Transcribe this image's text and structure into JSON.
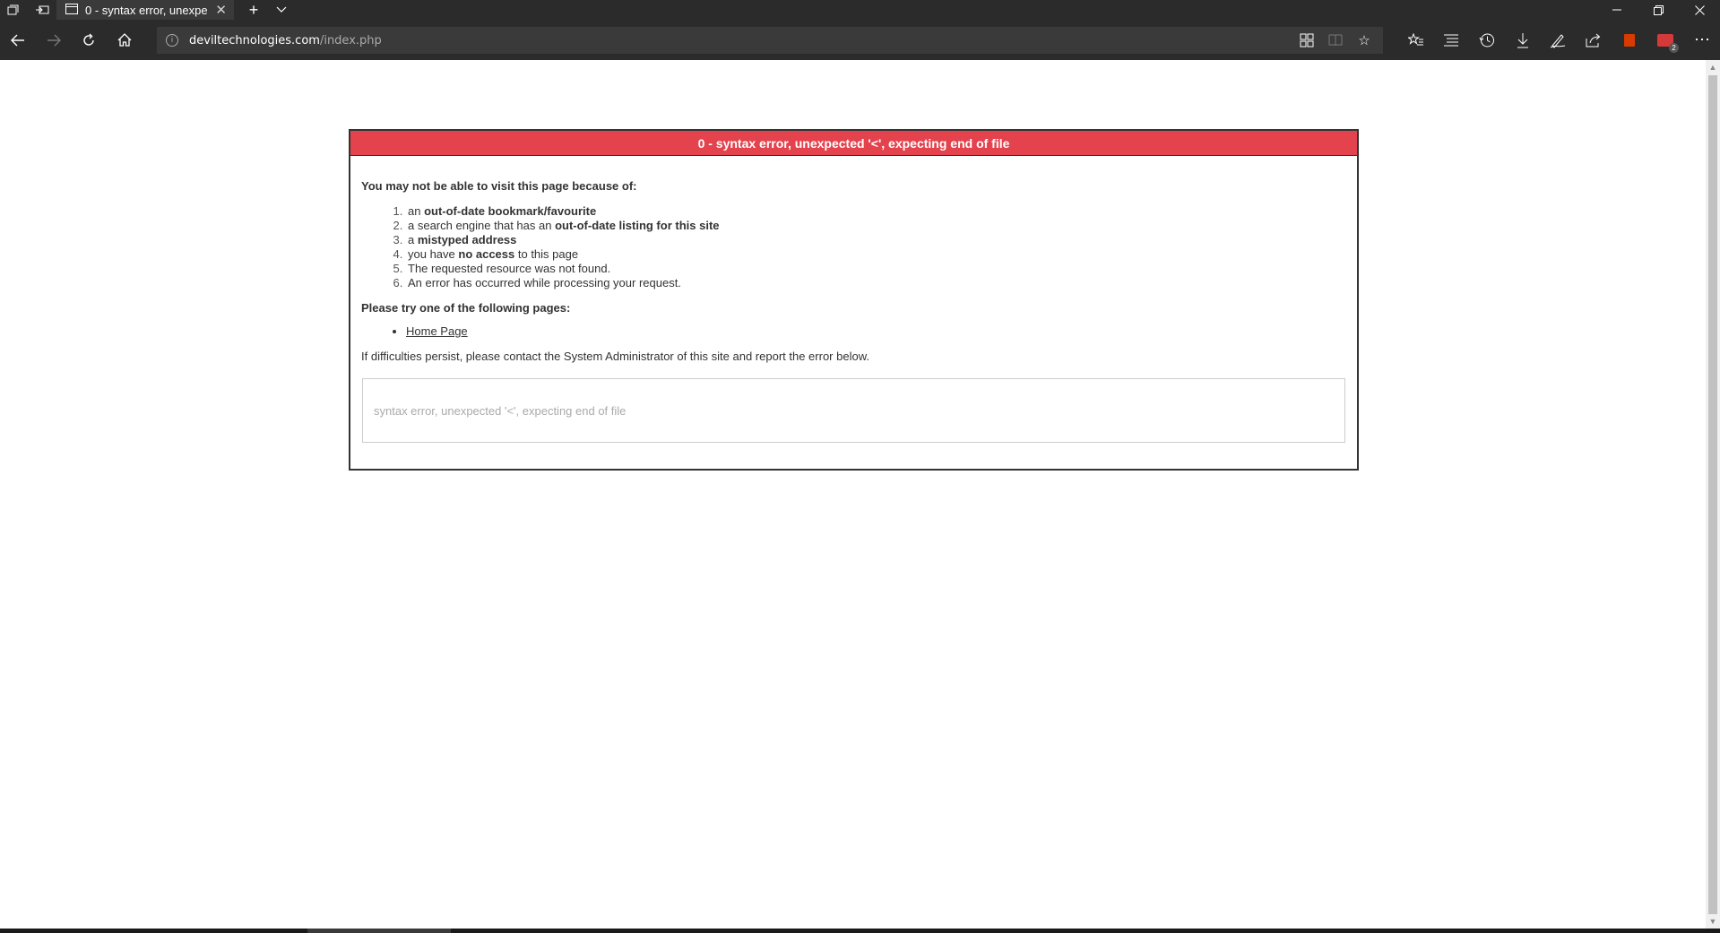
{
  "browser": {
    "tab_title": "0 - syntax error, unexpe",
    "address_domain": "deviltechnologies.com",
    "address_path": "/index.php",
    "extension_badge_count": "2"
  },
  "page": {
    "error_title": "0 - syntax error, unexpected '<', expecting end of file",
    "reasons_heading": "You may not be able to visit this page because of:",
    "reasons": [
      {
        "num": "1.",
        "pre": "an ",
        "bold": "out-of-date bookmark/favourite",
        "post": ""
      },
      {
        "num": "2.",
        "pre": "a search engine that has an ",
        "bold": "out-of-date listing for this site",
        "post": ""
      },
      {
        "num": "3.",
        "pre": "a ",
        "bold": "mistyped address",
        "post": ""
      },
      {
        "num": "4.",
        "pre": "you have ",
        "bold": "no access",
        "post": " to this page"
      },
      {
        "num": "5.",
        "pre": "The requested resource was not found.",
        "bold": "",
        "post": ""
      },
      {
        "num": "6.",
        "pre": "An error has occurred while processing your request.",
        "bold": "",
        "post": ""
      }
    ],
    "try_heading": "Please try one of the following pages:",
    "home_link": "Home Page",
    "contact_text": "If difficulties persist, please contact the System Administrator of this site and report the error below.",
    "error_detail": "syntax error, unexpected '<', expecting end of file"
  },
  "icons": {
    "tabs_aside": "tabs-aside-icon",
    "set_aside": "set-aside-icon",
    "tab_page": "page-icon",
    "close": "close-icon",
    "new_tab": "plus-icon",
    "tab_list": "chevron-down-icon",
    "back": "back-arrow-icon",
    "forward": "forward-arrow-icon",
    "refresh": "refresh-icon",
    "home": "home-icon"
  },
  "colors": {
    "error_header": "#e4424d",
    "chrome": "#2b2b2b"
  }
}
